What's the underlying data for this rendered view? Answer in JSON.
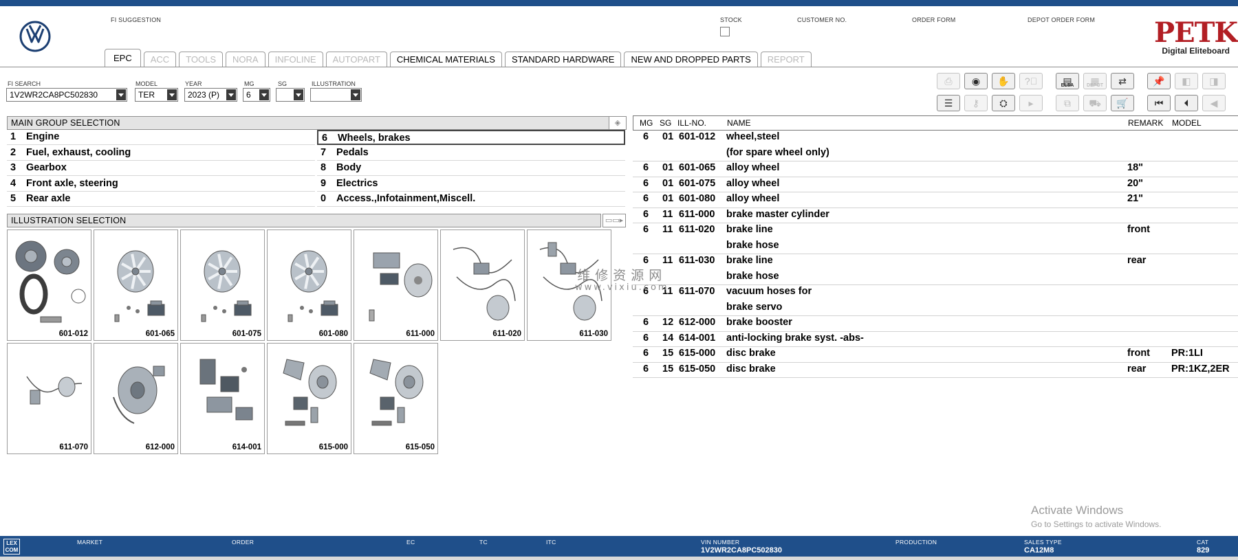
{
  "header": {
    "fi_suggestion_label": "FI SUGGESTION",
    "stock_label": "STOCK",
    "customer_no_label": "CUSTOMER NO.",
    "order_form_label": "ORDER FORM",
    "depot_order_form_label": "DEPOT ORDER FORM",
    "brand": {
      "name": "PETKA",
      "tagline": "Digital Eliteboard"
    }
  },
  "tabs": [
    {
      "label": "EPC",
      "active": true,
      "enabled": true
    },
    {
      "label": "ACC",
      "enabled": false
    },
    {
      "label": "TOOLS",
      "enabled": false
    },
    {
      "label": "NORA",
      "enabled": false
    },
    {
      "label": "INFOLINE",
      "enabled": false
    },
    {
      "label": "AUTOPART",
      "enabled": false
    },
    {
      "label": "CHEMICAL MATERIALS",
      "enabled": true
    },
    {
      "label": "STANDARD HARDWARE",
      "enabled": true
    },
    {
      "label": "NEW AND DROPPED PARTS",
      "enabled": true
    },
    {
      "label": "REPORT",
      "enabled": false
    }
  ],
  "filters": {
    "fi_search": {
      "label": "FI SEARCH",
      "value": "1V2WR2CA8PC502830"
    },
    "model": {
      "label": "MODEL",
      "value": "TER"
    },
    "year": {
      "label": "YEAR",
      "value": "2023 (P)"
    },
    "mg": {
      "label": "MG",
      "value": "6"
    },
    "sg": {
      "label": "SG",
      "value": ""
    },
    "illustration": {
      "label": "ILLUSTRATION",
      "value": ""
    }
  },
  "toolbar": {
    "row1": [
      {
        "icon": "print-icon",
        "enabled": false
      },
      {
        "icon": "disc-icon",
        "enabled": true
      },
      {
        "icon": "handshake-icon",
        "enabled": true
      },
      {
        "icon": "help-icon",
        "enabled": false
      },
      {
        "icon": "elsa-icon",
        "enabled": true,
        "caption": "ELSA"
      },
      {
        "icon": "depot-icon",
        "enabled": false,
        "caption": "DEPOT"
      },
      {
        "icon": "cart-transfer-icon",
        "enabled": true
      },
      {
        "icon": "pin-icon",
        "enabled": true
      },
      {
        "icon": "page-prev-icon",
        "enabled": false
      },
      {
        "icon": "page-next-icon",
        "enabled": false
      }
    ],
    "row2": [
      {
        "icon": "list-icon",
        "enabled": true
      },
      {
        "icon": "key-icon",
        "enabled": false
      },
      {
        "icon": "vehicle-icon",
        "enabled": true
      },
      {
        "icon": "play-icon",
        "enabled": false
      },
      {
        "icon": "compare-icon",
        "enabled": false
      },
      {
        "icon": "cart-user-icon",
        "enabled": false
      },
      {
        "icon": "cart-icon",
        "enabled": true
      },
      {
        "icon": "first-icon",
        "enabled": true
      },
      {
        "icon": "previous-icon",
        "enabled": true
      },
      {
        "icon": "back-icon",
        "enabled": false
      }
    ]
  },
  "main_group": {
    "header": "MAIN GROUP SELECTION",
    "left": [
      {
        "num": "1",
        "label": "Engine"
      },
      {
        "num": "2",
        "label": "Fuel, exhaust, cooling"
      },
      {
        "num": "3",
        "label": "Gearbox"
      },
      {
        "num": "4",
        "label": "Front axle, steering"
      },
      {
        "num": "5",
        "label": "Rear axle"
      }
    ],
    "right": [
      {
        "num": "6",
        "label": "Wheels, brakes",
        "selected": true
      },
      {
        "num": "7",
        "label": "Pedals"
      },
      {
        "num": "8",
        "label": "Body"
      },
      {
        "num": "9",
        "label": "Electrics"
      },
      {
        "num": "0",
        "label": "Access.,Infotainment,Miscell."
      }
    ]
  },
  "illustrations": {
    "header": "ILLUSTRATION SELECTION",
    "items": [
      {
        "code": "601-012",
        "kind": "wheel-steel"
      },
      {
        "code": "601-065",
        "kind": "alloy"
      },
      {
        "code": "601-075",
        "kind": "alloy"
      },
      {
        "code": "601-080",
        "kind": "alloy"
      },
      {
        "code": "611-000",
        "kind": "master"
      },
      {
        "code": "611-020",
        "kind": "lines"
      },
      {
        "code": "611-030",
        "kind": "lines2"
      },
      {
        "code": "611-070",
        "kind": "hose"
      },
      {
        "code": "612-000",
        "kind": "booster"
      },
      {
        "code": "614-001",
        "kind": "abs"
      },
      {
        "code": "615-000",
        "kind": "disc"
      },
      {
        "code": "615-050",
        "kind": "disc"
      }
    ]
  },
  "parts_table": {
    "columns": [
      "MG",
      "SG",
      "ILL-NO.",
      "NAME",
      "REMARK",
      "MODEL"
    ],
    "rows": [
      {
        "mg": "6",
        "sg": "01",
        "ill": "601-012",
        "name": [
          "wheel,steel",
          "(for spare wheel only)"
        ],
        "remark": "",
        "model": ""
      },
      {
        "mg": "6",
        "sg": "01",
        "ill": "601-065",
        "name": [
          "alloy wheel"
        ],
        "remark": "18\"",
        "model": ""
      },
      {
        "mg": "6",
        "sg": "01",
        "ill": "601-075",
        "name": [
          "alloy wheel"
        ],
        "remark": "20\"",
        "model": ""
      },
      {
        "mg": "6",
        "sg": "01",
        "ill": "601-080",
        "name": [
          "alloy wheel"
        ],
        "remark": "21\"",
        "model": ""
      },
      {
        "mg": "6",
        "sg": "11",
        "ill": "611-000",
        "name": [
          "brake master cylinder"
        ],
        "remark": "",
        "model": ""
      },
      {
        "mg": "6",
        "sg": "11",
        "ill": "611-020",
        "name": [
          "brake line",
          "brake hose"
        ],
        "remark": "front",
        "model": ""
      },
      {
        "mg": "6",
        "sg": "11",
        "ill": "611-030",
        "name": [
          "brake line",
          "brake hose"
        ],
        "remark": "rear",
        "model": ""
      },
      {
        "mg": "6",
        "sg": "11",
        "ill": "611-070",
        "name": [
          "vacuum hoses for",
          "brake servo"
        ],
        "remark": "",
        "model": ""
      },
      {
        "mg": "6",
        "sg": "12",
        "ill": "612-000",
        "name": [
          "brake booster"
        ],
        "remark": "",
        "model": ""
      },
      {
        "mg": "6",
        "sg": "14",
        "ill": "614-001",
        "name": [
          "anti-locking brake syst. -abs-"
        ],
        "remark": "",
        "model": ""
      },
      {
        "mg": "6",
        "sg": "15",
        "ill": "615-000",
        "name": [
          "disc brake"
        ],
        "remark": "front",
        "model": "PR:1LI"
      },
      {
        "mg": "6",
        "sg": "15",
        "ill": "615-050",
        "name": [
          "disc brake"
        ],
        "remark": "rear",
        "model": "PR:1KZ,2ER"
      }
    ]
  },
  "overlay": {
    "watermark_zh": "维修资源网",
    "watermark_url": "www.vixiu.com",
    "activate_title": "Activate Windows",
    "activate_sub": "Go to Settings to activate Windows."
  },
  "footer": {
    "logo": "LEX\nCOM",
    "fields": [
      {
        "label": "MARKET",
        "value": ""
      },
      {
        "label": "ORDER",
        "value": ""
      },
      {
        "label": "EC",
        "value": ""
      },
      {
        "label": "TC",
        "value": ""
      },
      {
        "label": "ITC",
        "value": ""
      },
      {
        "label": "VIN NUMBER",
        "value": "1V2WR2CA8PC502830"
      },
      {
        "label": "PRODUCTION",
        "value": ""
      },
      {
        "label": "SALES TYPE",
        "value": "CA12M8"
      },
      {
        "label": "CAT",
        "value": "829"
      }
    ]
  },
  "colors": {
    "brand_blue": "#1f4f8a",
    "petka_red": "#b21e24",
    "section_header_bg": "#e4e4e4",
    "disabled_text": "#b9b9b9"
  }
}
